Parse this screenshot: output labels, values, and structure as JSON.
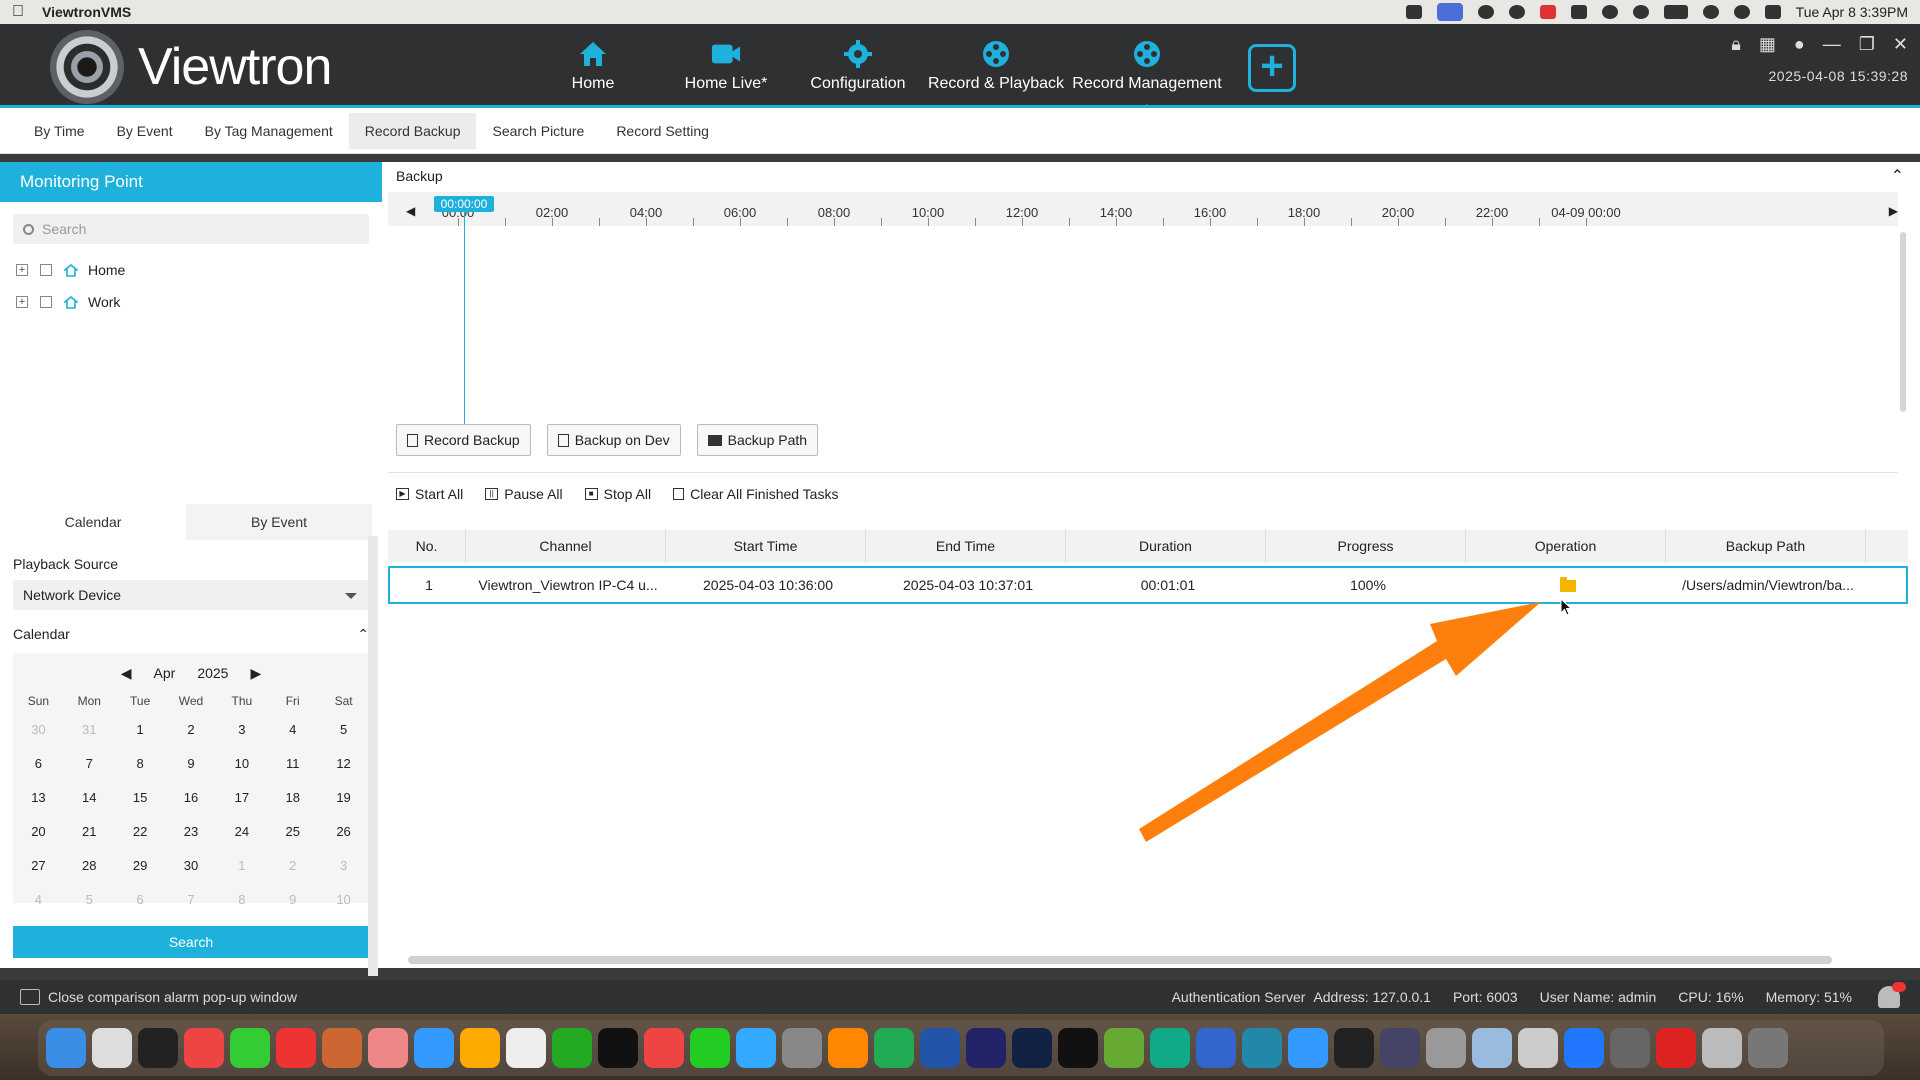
{
  "menubar": {
    "app_name": "ViewtronVMS",
    "clock": "Tue Apr 8  3:39PM"
  },
  "header": {
    "logo_text": "Viewtron",
    "datetime": "2025-04-08 15:39:28",
    "nav": [
      {
        "label": "Home",
        "icon": "home-icon"
      },
      {
        "label": "Home Live*",
        "icon": "camera-icon"
      },
      {
        "label": "Configuration",
        "icon": "gear-icon"
      },
      {
        "label": "Record & Playback",
        "icon": "film-reel-icon"
      },
      {
        "label": "Record Management",
        "icon": "film-reel-icon",
        "active": true
      }
    ],
    "add_label": "+"
  },
  "subtabs": [
    "By Time",
    "By Event",
    "By Tag Management",
    "Record Backup",
    "Search Picture",
    "Record Setting"
  ],
  "active_subtab": "Record Backup",
  "sidebar": {
    "title": "Monitoring Point",
    "search_placeholder": "Search",
    "tree": [
      {
        "label": "Home"
      },
      {
        "label": "Work"
      }
    ]
  },
  "calendar_panel": {
    "tabs": [
      "Calendar",
      "By Event"
    ],
    "playback_source_label": "Playback Source",
    "playback_source_value": "Network Device",
    "calendar_label": "Calendar",
    "month": "Apr",
    "year": "2025",
    "dow": [
      "Sun",
      "Mon",
      "Tue",
      "Wed",
      "Thu",
      "Fri",
      "Sat"
    ],
    "days": [
      [
        "30",
        "31",
        "1",
        "2",
        "3",
        "4",
        "5"
      ],
      [
        "6",
        "7",
        "8",
        "9",
        "10",
        "11",
        "12"
      ],
      [
        "13",
        "14",
        "15",
        "16",
        "17",
        "18",
        "19"
      ],
      [
        "20",
        "21",
        "22",
        "23",
        "24",
        "25",
        "26"
      ],
      [
        "27",
        "28",
        "29",
        "30",
        "1",
        "2",
        "3"
      ],
      [
        "4",
        "5",
        "6",
        "7",
        "8",
        "9",
        "10"
      ]
    ],
    "search_label": "Search"
  },
  "backup": {
    "title": "Backup",
    "cursor_time": "00:00:00",
    "ruler_labels": [
      "00:00",
      "02:00",
      "04:00",
      "06:00",
      "08:00",
      "10:00",
      "12:00",
      "14:00",
      "16:00",
      "18:00",
      "20:00",
      "22:00",
      "04-09 00:00"
    ],
    "buttons": [
      "Record Backup",
      "Backup on Dev",
      "Backup Path"
    ],
    "task_buttons": [
      "Start All",
      "Pause All",
      "Stop All",
      "Clear All Finished Tasks"
    ]
  },
  "table": {
    "columns": [
      "No.",
      "Channel",
      "Start Time",
      "End Time",
      "Duration",
      "Progress",
      "Operation",
      "Backup Path"
    ],
    "rows": [
      {
        "no": "1",
        "channel": "Viewtron_Viewtron IP-C4 u...",
        "start": "2025-04-03 10:36:00",
        "end": "2025-04-03 10:37:01",
        "duration": "00:01:01",
        "progress": "100%",
        "operation_icon": "folder-icon",
        "path": "/Users/admin/Viewtron/ba..."
      }
    ]
  },
  "statusbar": {
    "left": "Close comparison alarm pop-up window",
    "auth": "Authentication Server",
    "address": "Address: 127.0.0.1",
    "port": "Port: 6003",
    "user": "User Name: admin",
    "cpu": "CPU:  16%",
    "memory": "Memory:  51%"
  },
  "colors": {
    "accent": "#1eb1db",
    "annotation_arrow": "#ff7f0e",
    "folder": "#f5b400"
  }
}
